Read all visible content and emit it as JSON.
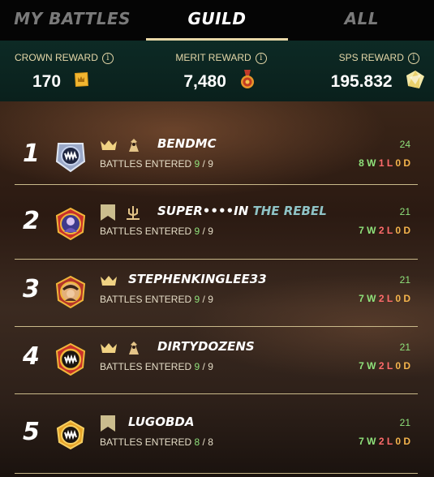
{
  "tabs": [
    {
      "label": "MY BATTLES",
      "active": false
    },
    {
      "label": "GUILD",
      "active": true
    },
    {
      "label": "ALL",
      "active": false
    }
  ],
  "rewards": {
    "crown": {
      "label": "CROWN REWARD",
      "value": "170",
      "icon": "crown-reward-icon"
    },
    "merit": {
      "label": "MERIT REWARD",
      "value": "7,480",
      "icon": "merit-medal-icon"
    },
    "sps": {
      "label": "SPS REWARD",
      "value": "195.832",
      "icon": "sps-token-icon"
    }
  },
  "entered_label": "BATTLES ENTERED",
  "leaderboard": [
    {
      "rank": "1",
      "name": "BENDMC",
      "title": "",
      "entered": "9",
      "total": "9",
      "score": "24",
      "w": "8 W",
      "l": "1 L",
      "d": "0 D",
      "badges": [
        "crown",
        "brawler"
      ],
      "avatar": "monster"
    },
    {
      "rank": "2",
      "name": "SUPER••••IN",
      "title": "THE REBEL",
      "entered": "9",
      "total": "9",
      "score": "21",
      "w": "7 W",
      "l": "2 L",
      "d": "0 D",
      "badges": [
        "banner",
        "guild-trident"
      ],
      "avatar": "rebel"
    },
    {
      "rank": "3",
      "name": "STEPHENKINGLEE33",
      "title": "",
      "entered": "9",
      "total": "9",
      "score": "21",
      "w": "7 W",
      "l": "2 L",
      "d": "0 D",
      "badges": [
        "crown"
      ],
      "avatar": "pirate"
    },
    {
      "rank": "4",
      "name": "DIRTYDOZENS",
      "title": "",
      "entered": "9",
      "total": "9",
      "score": "21",
      "w": "7 W",
      "l": "2 L",
      "d": "0 D",
      "badges": [
        "crown",
        "brawler"
      ],
      "avatar": "monster-gold"
    },
    {
      "rank": "5",
      "name": "LUGOBDA",
      "title": "",
      "entered": "8",
      "total": "8",
      "score": "21",
      "w": "7 W",
      "l": "2 L",
      "d": "0 D",
      "badges": [
        "banner"
      ],
      "avatar": "monster-gold-plain"
    }
  ],
  "colors": {
    "accent": "#e8d7a7",
    "win": "#8fe27b",
    "loss": "#ff6b6b",
    "draw": "#f4b44c",
    "title": "#8fc3c6",
    "rewards_bg": "#0d2a25"
  }
}
